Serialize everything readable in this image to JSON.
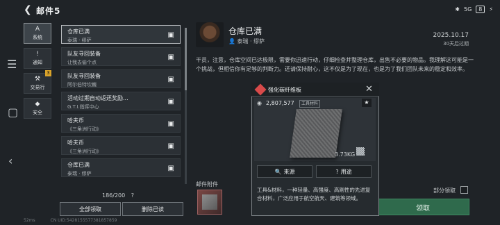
{
  "header": {
    "title": "邮件5",
    "battery": "8"
  },
  "categories": [
    {
      "label": "系统",
      "icon": "A"
    },
    {
      "label": "通知",
      "icon": "!"
    },
    {
      "label": "交易行",
      "icon": "⚒",
      "badge": "3"
    },
    {
      "label": "安全",
      "icon": "◆"
    }
  ],
  "mail_list": [
    {
      "title": "仓库已满",
      "sender": "泰瑞 · 缪萨"
    },
    {
      "title": "队友寻回装备",
      "sender": "让我去偷个点"
    },
    {
      "title": "队友寻回装备",
      "sender": "阿尔伯特坎巍"
    },
    {
      "title": "活动过期自动返还奖励...",
      "sender": "G.T.I.指挥中心"
    },
    {
      "title": "哈夫币",
      "sender": "《三角洲行动》"
    },
    {
      "title": "哈夫币",
      "sender": "《三角洲行动》"
    },
    {
      "title": "仓库已满",
      "sender": "泰瑞 · 缪萨"
    }
  ],
  "list_footer": {
    "count": "186/200",
    "help": "?",
    "claim_all": "全部领取",
    "delete_read": "删除已读"
  },
  "detail": {
    "title": "仓库已满",
    "sender": "泰瑞 · 缪萨",
    "date": "2025.10.17",
    "expire": "30天后过期",
    "body": "干员，注意，仓库空间已达极限，需要你迅速行动，仔细检查并整理仓库，出售不必要的物品。我理解这可能是一个挑战，但相信你有足够的判断力。还请保持耐心，这不仅是为了现在，也是为了我们团队未来的稳定和效率。",
    "attach_label": "邮件附件",
    "partial_claim": "部分领取",
    "claim": "领取"
  },
  "popup": {
    "title": "强化碳纤维板",
    "value": "2,807,577",
    "tag": "工具材料",
    "weight": "3.73KG",
    "source_btn": "来源",
    "use_btn": "用途",
    "description": "工具&材料，一种轻量、高强度、高刚性的先进复合材料，广泛应用于航空航天、建筑等领域。"
  },
  "footer": {
    "uid": "CN UID:5428155577381857859",
    "ping": "52ms"
  }
}
